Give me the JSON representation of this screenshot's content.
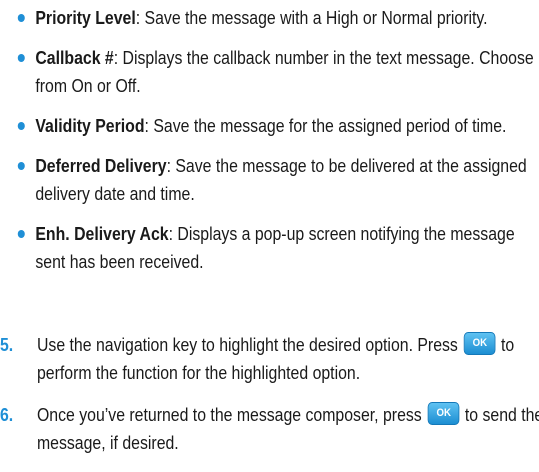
{
  "bullets": [
    {
      "term": "Priority Level",
      "desc": ": Save the message with a High or Normal priority."
    },
    {
      "term": "Callback #",
      "desc": ": Displays the callback number in the text message. Choose from On or Off."
    },
    {
      "term": "Validity Period",
      "desc": ": Save the message for the assigned period of time."
    },
    {
      "term": "Deferred Delivery",
      "desc": ": Save the message to be delivered at the assigned delivery date and time."
    },
    {
      "term": "Enh. Delivery Ack",
      "desc": ": Displays a pop-up screen notifying the message sent has been received."
    }
  ],
  "steps": [
    {
      "number": "5.",
      "before_key": "Use the navigation key to highlight the desired option. Press",
      "after_key": "to perform the function for the highlighted option."
    },
    {
      "number": "6.",
      "before_key": "Once you’ve returned to the message composer, press",
      "after_key": "to send the message, if desired."
    }
  ],
  "ok_key": {
    "label": "OK",
    "icon": "ok-key-icon",
    "color": "#1f8fd6"
  },
  "accent_color": "#1f8fd6"
}
